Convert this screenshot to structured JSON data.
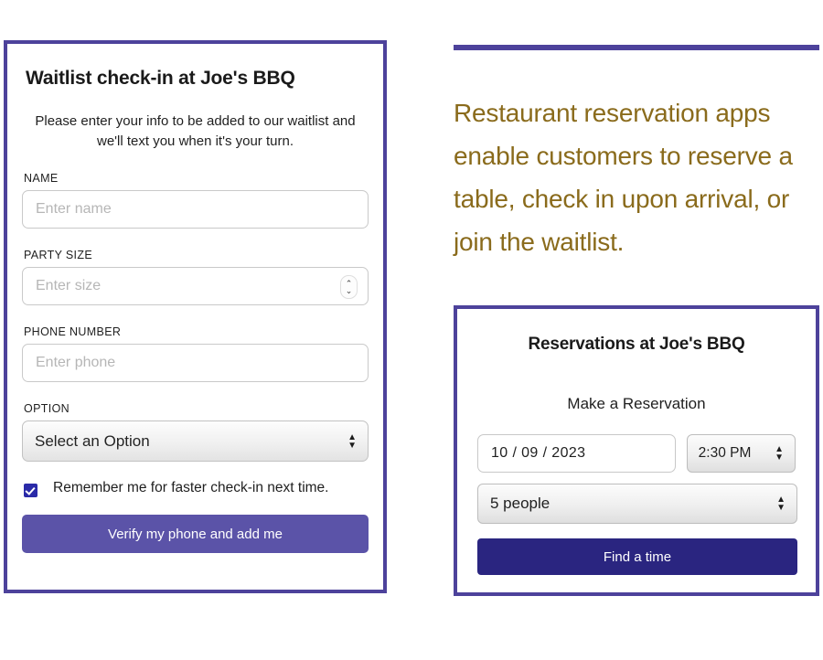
{
  "waitlist": {
    "title": "Waitlist check-in at Joe's BBQ",
    "subtitle": "Please enter your info to be added to our waitlist and we'll text you when it's your turn.",
    "fields": [
      {
        "label": "NAME",
        "placeholder": "Enter name",
        "value": ""
      },
      {
        "label": "PARTY SIZE",
        "placeholder": "Enter size",
        "value": ""
      },
      {
        "label": "PHONE NUMBER",
        "placeholder": "Enter phone",
        "value": ""
      }
    ],
    "option_label": "OPTION",
    "option_value": "Select an Option",
    "remember_label": "Remember me for faster check-in next time.",
    "remember_checked": "true",
    "submit_label": "Verify my phone and add me"
  },
  "callout": {
    "text": "Restaurant reservation apps enable customers to reserve a table, check in upon arrival, or join the waitlist."
  },
  "reservation": {
    "title": "Reservations at Joe's BBQ",
    "subtitle": "Make a Reservation",
    "date_value": "10 / 09 / 2023",
    "time_value": "2:30 PM",
    "party_value": "5 people",
    "submit_label": "Find a time"
  },
  "icons": {
    "caret_up": "▲",
    "caret_down": "▼",
    "chevron_up": "⌃",
    "chevron_down": "⌄"
  },
  "colors": {
    "border_purple": "#4d429b",
    "waitlist_button": "#5b53a8",
    "reservation_button": "#2a2580",
    "callout_text": "#8a6b1c",
    "checkbox": "#2a2aa8"
  }
}
